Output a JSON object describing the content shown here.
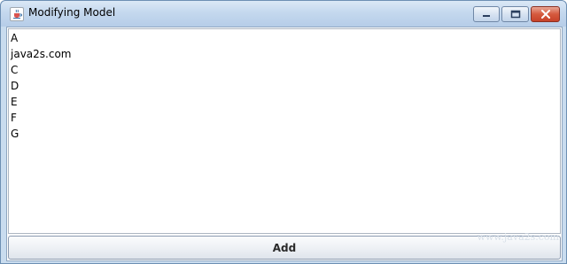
{
  "window": {
    "title": "Modifying Model",
    "app_icon": "java-cup-icon",
    "controls": [
      "minimize-icon",
      "maximize-icon",
      "close-icon"
    ]
  },
  "list": {
    "items": [
      "A",
      "java2s.com",
      "C",
      "D",
      "E",
      "F",
      "G"
    ]
  },
  "add_button": {
    "label": "Add"
  },
  "watermark": "www.java2s.com"
}
